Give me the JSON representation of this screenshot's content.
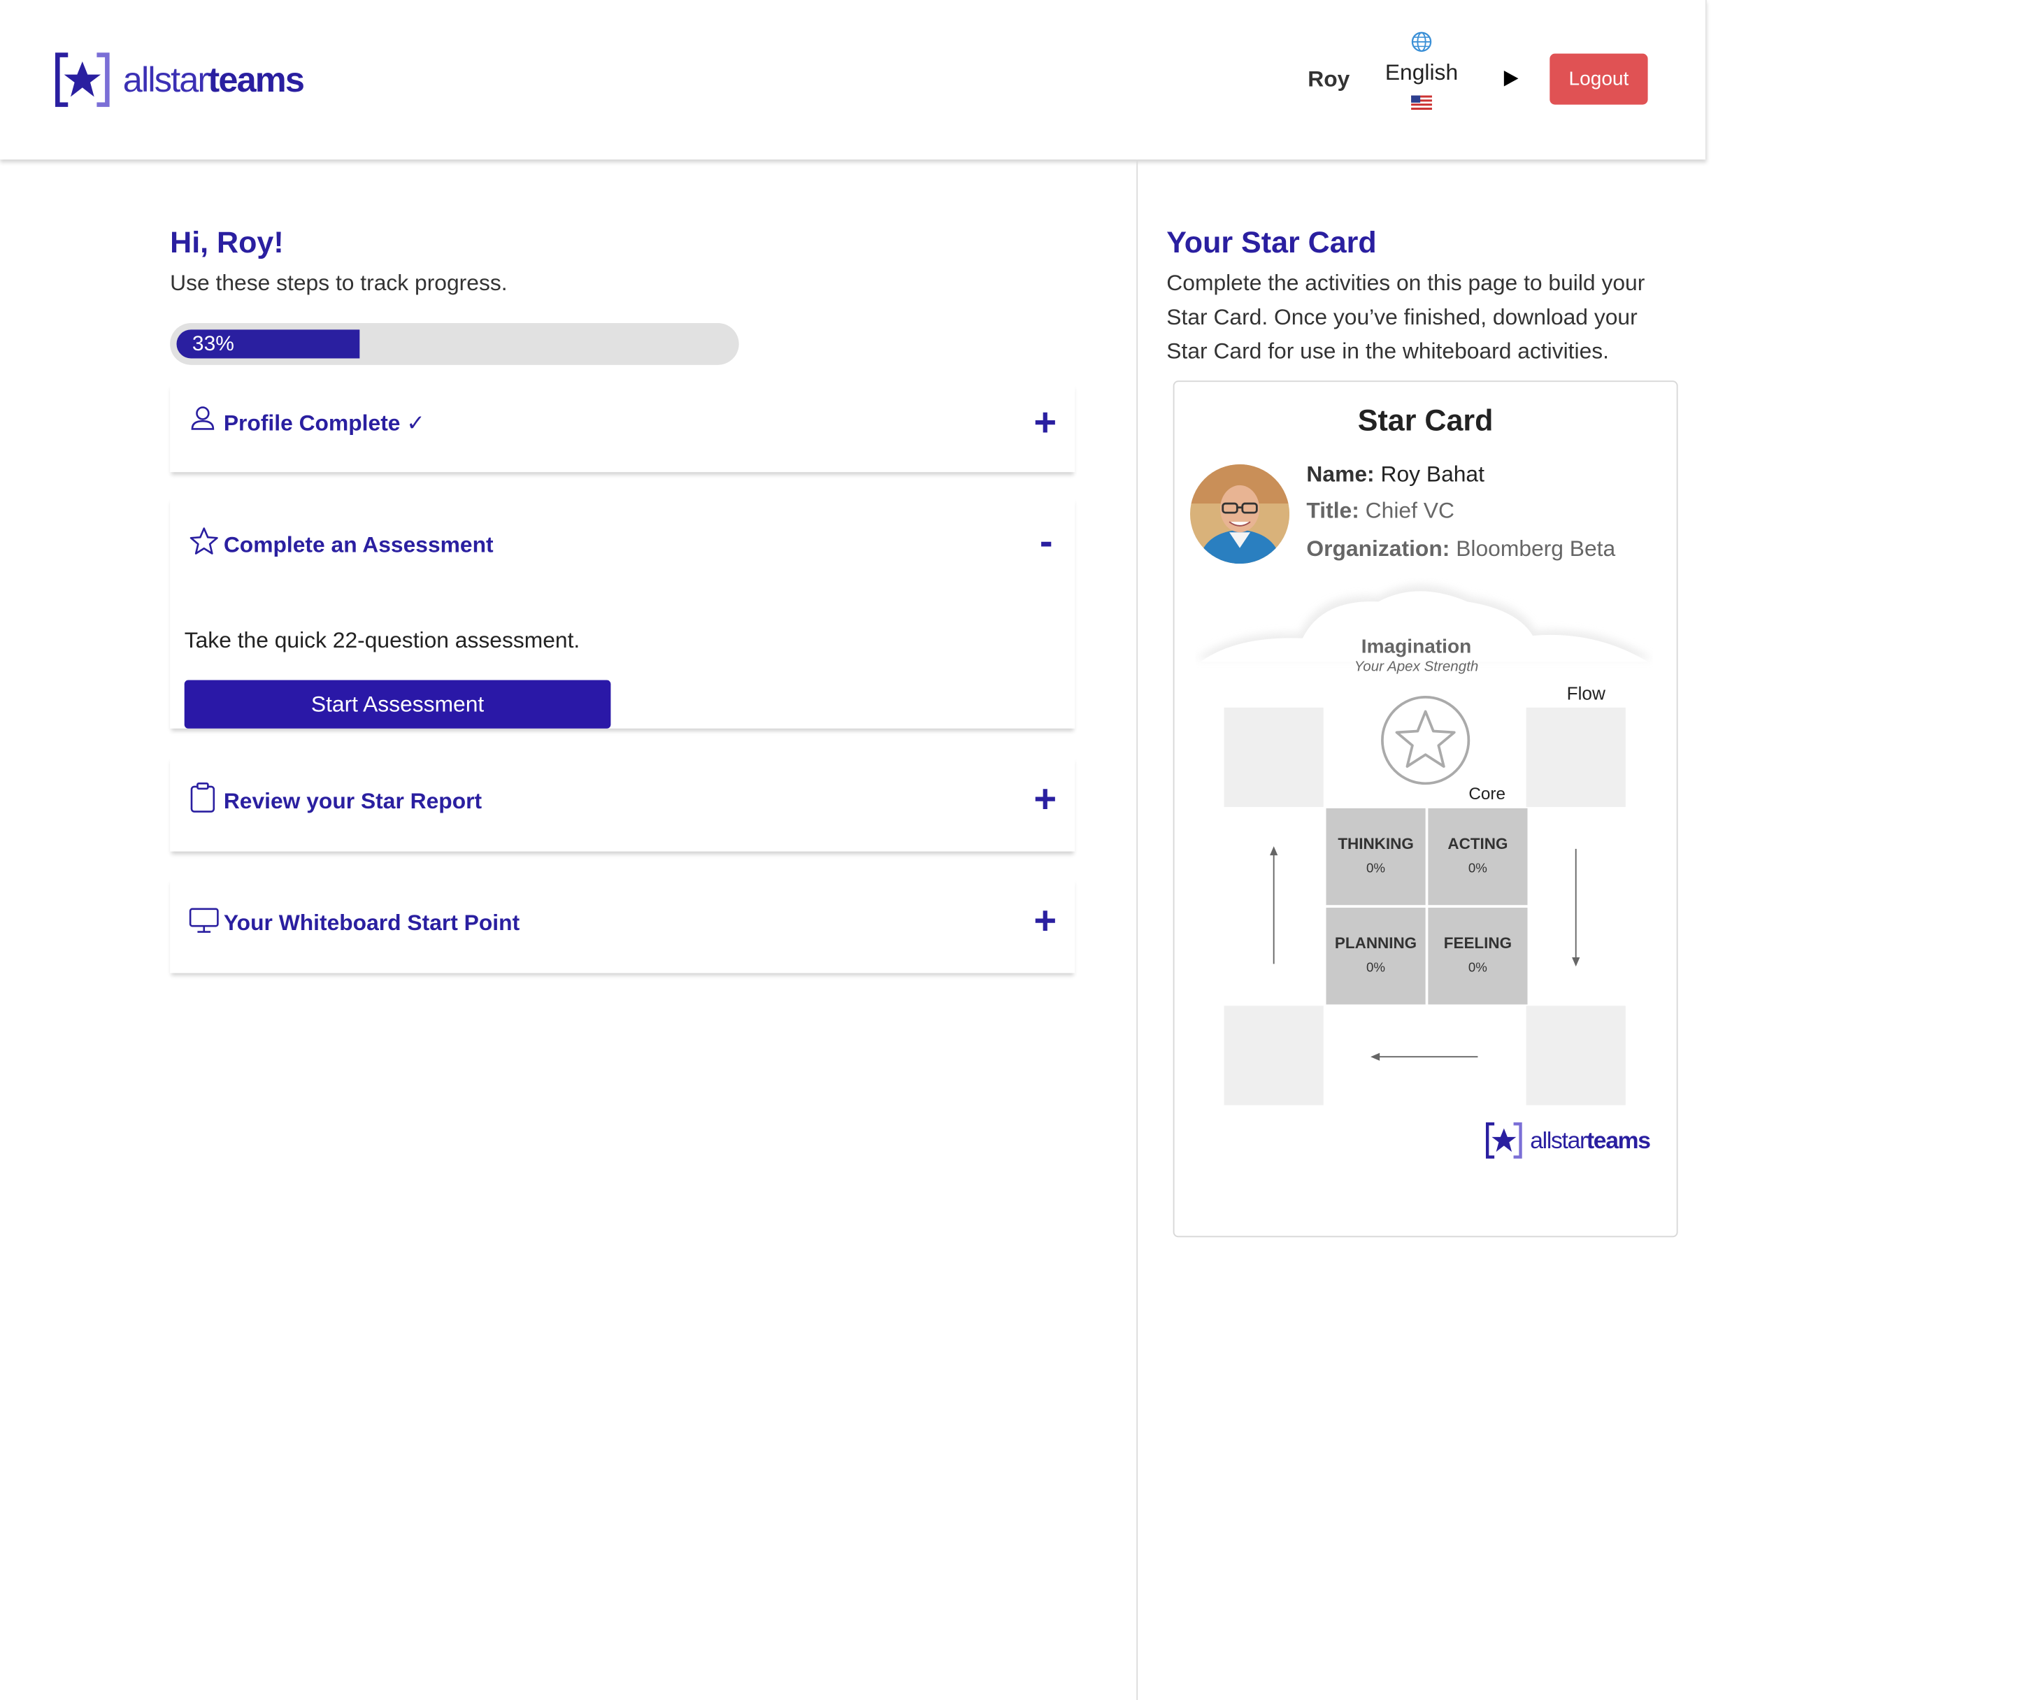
{
  "brand": {
    "wordmark_light": "allstar",
    "wordmark_bold": "teams",
    "color": "#2a1fa0"
  },
  "header": {
    "user_name": "Roy",
    "language": "English",
    "logout_label": "Logout",
    "logout_color": "#e05254"
  },
  "left": {
    "greeting": "Hi, Roy!",
    "subtitle": "Use these steps to track progress.",
    "progress": {
      "label": "33%",
      "value": 0.33
    },
    "steps": [
      {
        "title": "Profile Complete ✓",
        "icon": "user-icon",
        "toggle": "+",
        "expanded": false
      },
      {
        "title": "Complete an Assessment",
        "icon": "star-outline-icon",
        "toggle": "-",
        "expanded": true,
        "body_text": "Take the quick 22-question assessment.",
        "button_label": "Start Assessment"
      },
      {
        "title": "Review your Star Report",
        "icon": "clipboard-icon",
        "toggle": "+",
        "expanded": false
      },
      {
        "title": "Your Whiteboard Start Point",
        "icon": "monitor-icon",
        "toggle": "+",
        "expanded": false
      }
    ]
  },
  "right": {
    "title": "Your Star Card",
    "description": "Complete the activities on this page to build your Star Card. Once you’ve finished, download your Star Card for use in the whiteboard activities.",
    "card": {
      "title": "Star Card",
      "name_label": "Name:",
      "name_value": "Roy Bahat",
      "title_label": "Title:",
      "title_value": "Chief VC",
      "org_label": "Organization:",
      "org_value": "Bloomberg Beta",
      "apex_name": "Imagination",
      "apex_sub": "Your Apex Strength",
      "flow_label": "Flow",
      "core_label": "Core",
      "quadrants": [
        {
          "name": "THINKING",
          "value": "0%"
        },
        {
          "name": "ACTING",
          "value": "0%"
        },
        {
          "name": "PLANNING",
          "value": "0%"
        },
        {
          "name": "FEELING",
          "value": "0%"
        }
      ]
    }
  }
}
